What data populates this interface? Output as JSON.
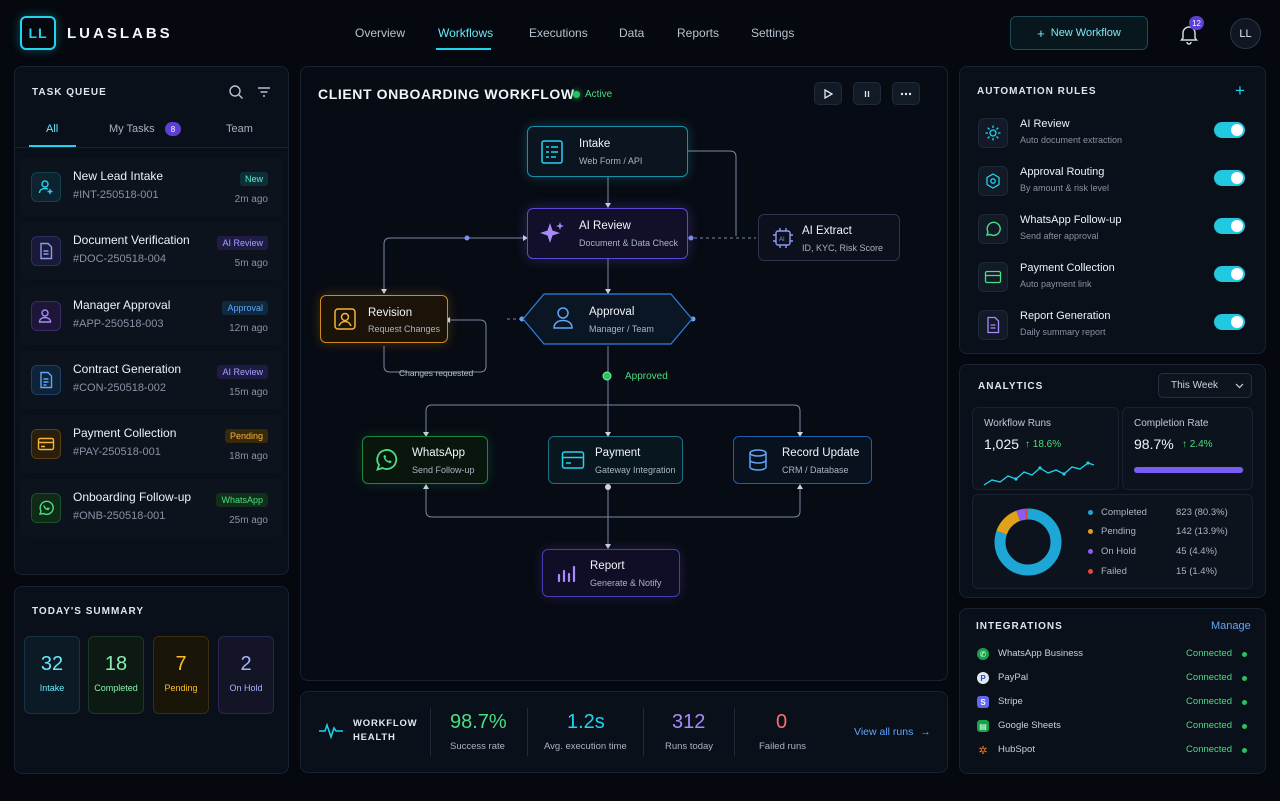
{
  "brand": {
    "logo": "LL",
    "name": "LUASLABS"
  },
  "nav": {
    "items": [
      "Overview",
      "Workflows",
      "Executions",
      "Data",
      "Reports",
      "Settings"
    ],
    "active": "Workflows"
  },
  "header": {
    "new_workflow": "New Workflow",
    "notifications": "12",
    "avatar": "LL"
  },
  "task_queue": {
    "title": "TASK QUEUE",
    "tabs": [
      "All",
      "My Tasks",
      "Team"
    ],
    "my_tasks_count": "8",
    "tasks": [
      {
        "title": "New Lead Intake",
        "id": "#INT-250518-001",
        "tag": "New",
        "time": "2m ago",
        "icon": "user-plus-icon"
      },
      {
        "title": "Document Verification",
        "id": "#DOC-250518-004",
        "tag": "AI Review",
        "time": "5m ago",
        "icon": "document-icon"
      },
      {
        "title": "Manager Approval",
        "id": "#APP-250518-003",
        "tag": "Approval",
        "time": "12m ago",
        "icon": "user-check-icon"
      },
      {
        "title": "Contract Generation",
        "id": "#CON-250518-002",
        "tag": "AI Review",
        "time": "15m ago",
        "icon": "contract-icon"
      },
      {
        "title": "Payment Collection",
        "id": "#PAY-250518-001",
        "tag": "Pending",
        "time": "18m ago",
        "icon": "card-icon"
      },
      {
        "title": "Onboarding Follow-up",
        "id": "#ONB-250518-001",
        "tag": "WhatsApp",
        "time": "25m ago",
        "icon": "whatsapp-icon"
      }
    ]
  },
  "summary": {
    "title": "TODAY'S SUMMARY",
    "cards": [
      {
        "value": "32",
        "label": "Intake"
      },
      {
        "value": "18",
        "label": "Completed"
      },
      {
        "value": "7",
        "label": "Pending"
      },
      {
        "value": "2",
        "label": "On Hold"
      }
    ]
  },
  "workflow": {
    "title": "CLIENT ONBOARDING WORKFLOW",
    "status": "Active",
    "nodes": {
      "intake": {
        "title": "Intake",
        "sub": "Web Form / API"
      },
      "ai_review": {
        "title": "AI Review",
        "sub": "Document & Data Check"
      },
      "ai_extract": {
        "title": "AI Extract",
        "sub": "ID, KYC, Risk Score"
      },
      "revision": {
        "title": "Revision",
        "sub": "Request Changes"
      },
      "approval": {
        "title": "Approval",
        "sub": "Manager / Team"
      },
      "whatsapp": {
        "title": "WhatsApp",
        "sub": "Send Follow-up"
      },
      "payment": {
        "title": "Payment",
        "sub": "Gateway Integration"
      },
      "record": {
        "title": "Record Update",
        "sub": "CRM / Database"
      },
      "report": {
        "title": "Report",
        "sub": "Generate & Notify"
      }
    },
    "labels": {
      "approved": "Approved",
      "changes": "Changes requested"
    }
  },
  "health": {
    "title_line1": "WORKFLOW",
    "title_line2": "HEALTH",
    "metrics": [
      {
        "value": "98.7%",
        "label": "Success rate",
        "color": "#4ade80"
      },
      {
        "value": "1.2s",
        "label": "Avg. execution time",
        "color": "#22d3ee"
      },
      {
        "value": "312",
        "label": "Runs today",
        "color": "#a78bfa"
      },
      {
        "value": "0",
        "label": "Failed runs",
        "color": "#f87171"
      }
    ],
    "view_all": "View all runs"
  },
  "automation": {
    "title": "AUTOMATION RULES",
    "rules": [
      {
        "title": "AI Review",
        "sub": "Auto document extraction",
        "on": true
      },
      {
        "title": "Approval Routing",
        "sub": "By amount & risk level",
        "on": true
      },
      {
        "title": "WhatsApp Follow-up",
        "sub": "Send after approval",
        "on": true
      },
      {
        "title": "Payment Collection",
        "sub": "Auto payment link",
        "on": true
      },
      {
        "title": "Report Generation",
        "sub": "Daily summary report",
        "on": true
      }
    ]
  },
  "analytics": {
    "title": "ANALYTICS",
    "period": "This Week",
    "runs": {
      "label": "Workflow Runs",
      "value": "1,025",
      "delta": "18.6%"
    },
    "completion": {
      "label": "Completion Rate",
      "value": "98.7%",
      "delta": "2.4%",
      "fraction": 0.987
    },
    "breakdown": [
      {
        "name": "Completed",
        "value": "823 (80.3%)",
        "pct": 80.3,
        "color": "#1ea7d6"
      },
      {
        "name": "Pending",
        "value": "142 (13.9%)",
        "pct": 13.9,
        "color": "#e0a21b"
      },
      {
        "name": "On Hold",
        "value": "45 (4.4%)",
        "pct": 4.4,
        "color": "#8b5cf6"
      },
      {
        "name": "Failed",
        "value": "15 (1.4%)",
        "pct": 1.4,
        "color": "#ef4444"
      }
    ]
  },
  "integrations": {
    "title": "INTEGRATIONS",
    "manage": "Manage",
    "items": [
      {
        "name": "WhatsApp Business",
        "status": "Connected"
      },
      {
        "name": "PayPal",
        "status": "Connected"
      },
      {
        "name": "Stripe",
        "status": "Connected"
      },
      {
        "name": "Google Sheets",
        "status": "Connected"
      },
      {
        "name": "HubSpot",
        "status": "Connected"
      }
    ]
  }
}
